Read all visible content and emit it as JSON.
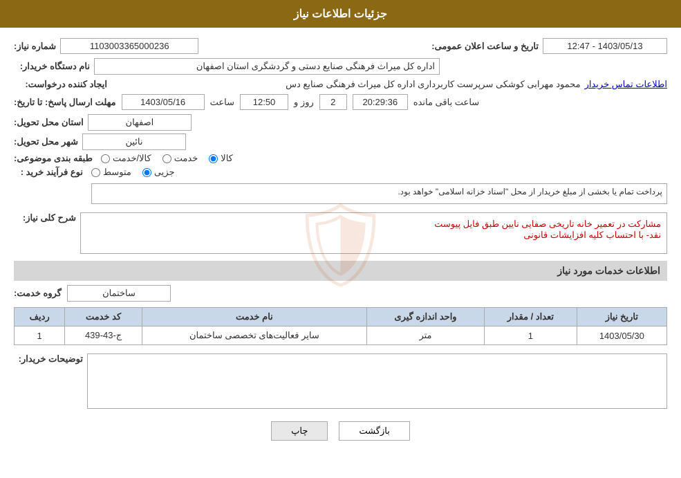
{
  "header": {
    "title": "جزئیات اطلاعات نیاز"
  },
  "fields": {
    "shomare_niaz_label": "شماره نیاز:",
    "shomare_niaz_value": "1103003365000236",
    "nam_dastgah_label": "نام دستگاه خریدار:",
    "nam_dastgah_value": "اداره کل میراث فرهنگی  صنایع دستی و گردشگری استان اصفهان",
    "ijad_konande_label": "ایجاد کننده درخواست:",
    "ijad_konande_value": "محمود مهرابی کوشکی سرپرست کاربرداری اداره کل میراث فرهنگی  صنایع دس",
    "ejad_link": "اطلاعات تماس خریدار",
    "mohlat_label": "مهلت ارسال پاسخ: تا تاریخ:",
    "date_value": "1403/05/16",
    "saat_label": "ساعت",
    "saat_value": "12:50",
    "rooz_label": "روز و",
    "rooz_value": "2",
    "remaining_label": "ساعت باقی مانده",
    "remaining_value": "20:29:36",
    "ostan_label": "استان محل تحویل:",
    "ostan_value": "اصفهان",
    "shahr_label": "شهر محل تحویل:",
    "shahr_value": "نائین",
    "tabaghebandi_label": "طبقه بندی موضوعی:",
    "radio_kala": "کالا",
    "radio_khadamat": "خدمت",
    "radio_kala_khadamat": "کالا/خدمت",
    "nooe_farayand_label": "نوع فرآیند خرید :",
    "radio_jozee": "جزیی",
    "radio_motevaset": "متوسط",
    "note_farayand": "پرداخت تمام یا بخشی از مبلغ خریدار از محل \"اسناد خزانه اسلامی\" خواهد بود.",
    "sharh_label": "شرح کلی نیاز:",
    "sharh_value": "مشارکت در تعمیر خانه تاریخی صفایی نایین طبق فایل پیوست\nنقد- با احتساب کلیه افزایشات قانونی",
    "khadamat_section": "اطلاعات خدمات مورد نیاز",
    "group_service_label": "گروه خدمت:",
    "group_service_value": "ساختمان",
    "table_headers": {
      "radif": "ردیف",
      "kod_khadamat": "کد خدمت",
      "nam_khadamat": "نام خدمت",
      "vahed_andazegiri": "واحد اندازه گیری",
      "tedad_megdar": "تعداد / مقدار",
      "tarikh_niaz": "تاریخ نیاز"
    },
    "table_rows": [
      {
        "radif": "1",
        "kod": "ج-43-439",
        "nam": "سایر فعالیت‌های تخصصی ساختمان",
        "vahed": "متر",
        "tedad": "1",
        "tarikh": "1403/05/30"
      }
    ],
    "tosihaat_label": "توضیحات خریدار:",
    "tosihaat_value": "",
    "btn_back": "بازگشت",
    "btn_print": "چاپ",
    "tarikh_saat_label": "تاریخ و ساعت اعلان عمومی:",
    "tarikh_saat_value": "1403/05/13 - 12:47"
  }
}
